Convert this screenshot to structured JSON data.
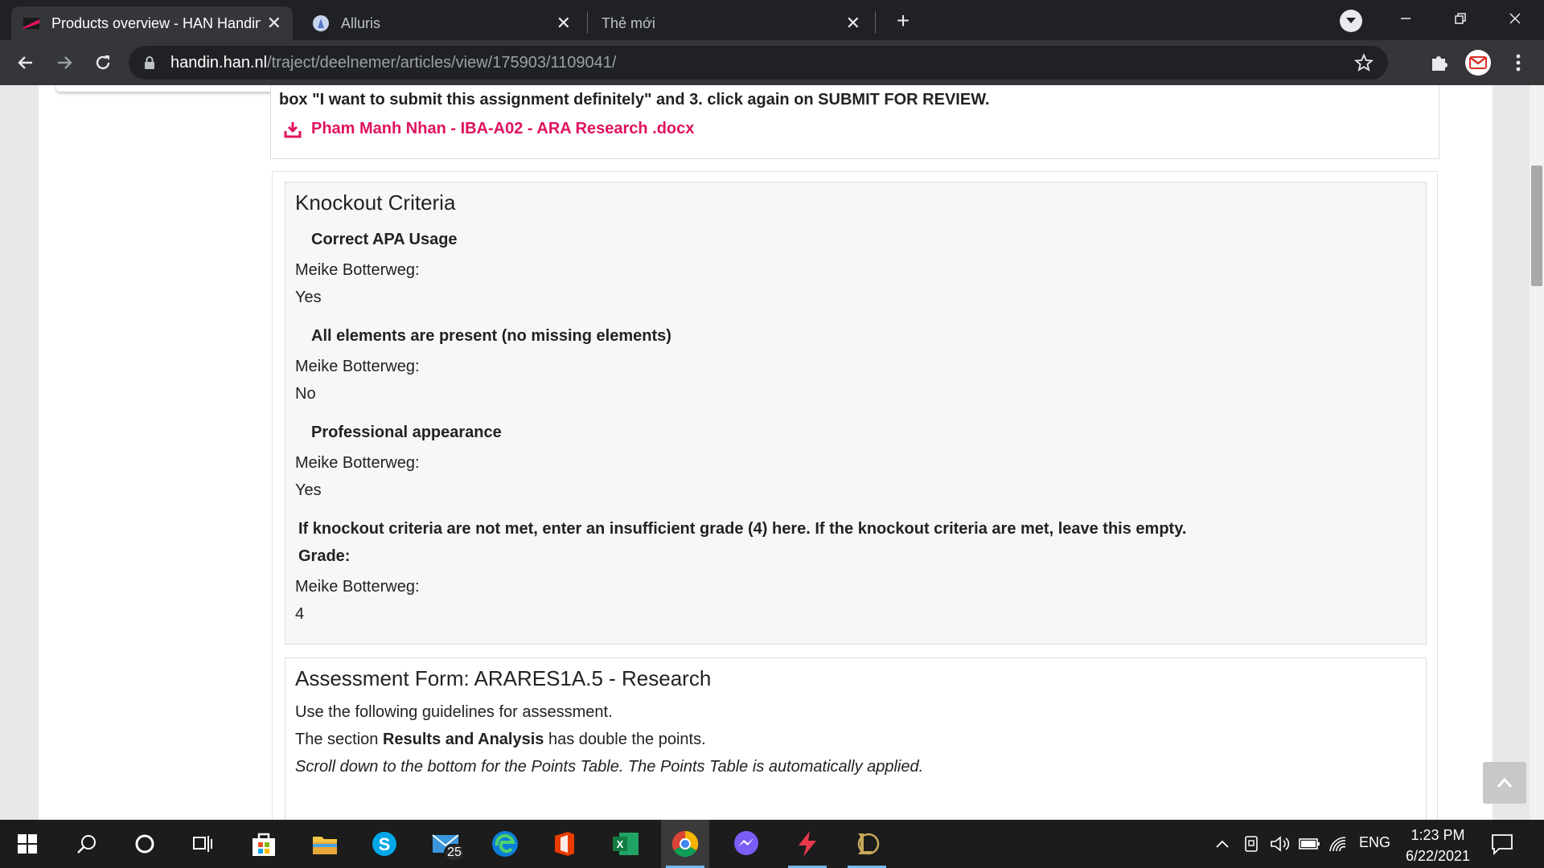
{
  "browser": {
    "tabs": [
      {
        "title": "Products overview - HAN Handin",
        "active": true
      },
      {
        "title": "Alluris",
        "active": false
      },
      {
        "title": "Thẻ mới",
        "active": false
      }
    ],
    "url_host": "handin.han.nl",
    "url_path": "/traject/deelnemer/articles/view/175903/1109041/"
  },
  "submission": {
    "instruction_tail": "box \"I want to submit this assignment definitely\" and 3. click again on SUBMIT FOR REVIEW.",
    "file_link": "Pham Manh Nhan - IBA-A02 - ARA Research .docx"
  },
  "knockout": {
    "title": "Knockout Criteria",
    "criteria": [
      {
        "name": "Correct APA Usage",
        "reviewer": "Meike Botterweg:",
        "answer": "Yes"
      },
      {
        "name": "All elements are present (no missing elements)",
        "reviewer": "Meike Botterweg:",
        "answer": "No"
      },
      {
        "name": "Professional appearance",
        "reviewer": "Meike Botterweg:",
        "answer": "Yes"
      }
    ],
    "grade_instruction": "If knockout criteria are not met, enter an insufficient grade (4) here. If the knockout criteria are met, leave this empty.",
    "grade_label": "Grade:",
    "grade_reviewer": "Meike Botterweg:",
    "grade_value": "4"
  },
  "assessment": {
    "title": "Assessment Form: ARARES1A.5 - Research",
    "line1": "Use the following guidelines for assessment.",
    "line2_prefix": "The section ",
    "line2_bold": "Results and Analysis",
    "line2_suffix": " has double the points.",
    "line3": "Scroll down to the bottom for the Points Table. The Points Table is automatically applied."
  },
  "taskbar": {
    "mail_badge": "25",
    "language": "ENG",
    "time": "1:23 PM",
    "date": "6/22/2021"
  },
  "icons": {
    "tab1": "handin-favicon",
    "tab2": "alluris-favicon",
    "taskbar": [
      "windows-start-icon",
      "search-icon",
      "cortana-icon",
      "task-view-icon",
      "store-icon",
      "file-explorer-icon",
      "skype-icon",
      "mail-icon",
      "edge-icon",
      "office-icon",
      "excel-icon",
      "chrome-icon",
      "messenger-icon",
      "lightning-app-icon",
      "league-of-legends-icon"
    ]
  },
  "colors": {
    "link": "#e0115f",
    "tab_bar": "#202124",
    "toolbar": "#35363a",
    "taskbar": "#1c1c1c"
  }
}
